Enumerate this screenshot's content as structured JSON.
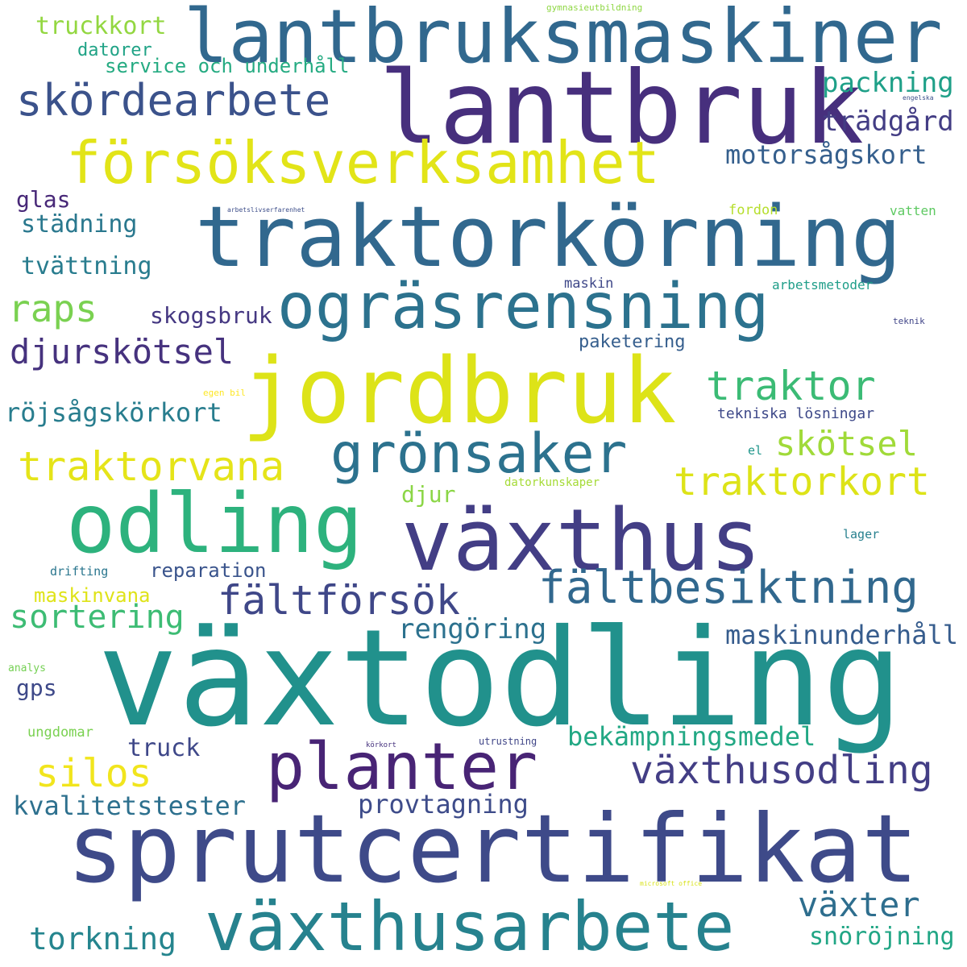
{
  "words": [
    {
      "text": "växtodling",
      "color": "#21918c"
    },
    {
      "text": "sprutcertifikat",
      "color": "#3e4a89"
    },
    {
      "text": "lantbruk",
      "color": "#472f7d"
    },
    {
      "text": "traktorkörning",
      "color": "#31688e"
    },
    {
      "text": "lantbruksmaskiner",
      "color": "#31688e"
    },
    {
      "text": "jordbruk",
      "color": "#dde318"
    },
    {
      "text": "växthus",
      "color": "#433e85"
    },
    {
      "text": "ogräsrensning",
      "color": "#2c728e"
    },
    {
      "text": "försöksverksamhet",
      "color": "#e2e418"
    },
    {
      "text": "odling",
      "color": "#2db27d"
    },
    {
      "text": "växthusarbete",
      "color": "#26828e"
    },
    {
      "text": "planter",
      "color": "#482475"
    },
    {
      "text": "grönsaker",
      "color": "#2c728e"
    },
    {
      "text": "fältbesiktning",
      "color": "#31688e"
    },
    {
      "text": "skördearbete",
      "color": "#3b528b"
    },
    {
      "text": "fältförsök",
      "color": "#3f4788"
    },
    {
      "text": "växthusodling",
      "color": "#433e85"
    },
    {
      "text": "traktorvana",
      "color": "#e5e419"
    },
    {
      "text": "traktorkort",
      "color": "#dde318"
    },
    {
      "text": "djurskötsel",
      "color": "#46327e"
    },
    {
      "text": "traktor",
      "color": "#3bbb75"
    },
    {
      "text": "raps",
      "color": "#7ad151"
    },
    {
      "text": "silos",
      "color": "#f1e51d"
    },
    {
      "text": "sortering",
      "color": "#3dbc74"
    },
    {
      "text": "skötsel",
      "color": "#a0da39"
    },
    {
      "text": "växter",
      "color": "#2e6e8e"
    },
    {
      "text": "röjsågskörkort",
      "color": "#287d8e"
    },
    {
      "text": "bekämpningsmedel",
      "color": "#22a884"
    },
    {
      "text": "kvalitetstester",
      "color": "#2d708e"
    },
    {
      "text": "provtagning",
      "color": "#3e4c8a"
    },
    {
      "text": "torkning",
      "color": "#25858e"
    },
    {
      "text": "snöröjning",
      "color": "#21a685"
    },
    {
      "text": "packning",
      "color": "#1fa088"
    },
    {
      "text": "trädgård",
      "color": "#433d84"
    },
    {
      "text": "motorsågskort",
      "color": "#355f8d"
    },
    {
      "text": "maskinunderhåll",
      "color": "#365c8d"
    },
    {
      "text": "rengöring",
      "color": "#2c718e"
    },
    {
      "text": "truckkort",
      "color": "#93d741"
    },
    {
      "text": "tvättning",
      "color": "#287c8e"
    },
    {
      "text": "städning",
      "color": "#2a788e"
    },
    {
      "text": "skogsbruk",
      "color": "#453882"
    },
    {
      "text": "reparation",
      "color": "#3a548c"
    },
    {
      "text": "maskinvana",
      "color": "#dfe318"
    },
    {
      "text": "service och underhåll",
      "color": "#25ab82"
    },
    {
      "text": "datorer",
      "color": "#20a386"
    },
    {
      "text": "glas",
      "color": "#482878"
    },
    {
      "text": "truck",
      "color": "#3f4889"
    },
    {
      "text": "djur",
      "color": "#8bd646"
    },
    {
      "text": "gps",
      "color": "#3e4989"
    },
    {
      "text": "paketering",
      "color": "#355e8d"
    },
    {
      "text": "tekniska lösningar",
      "color": "#3e4989"
    },
    {
      "text": "fordon",
      "color": "#b5de2b"
    },
    {
      "text": "vatten",
      "color": "#5ec962"
    },
    {
      "text": "maskin",
      "color": "#3f4889"
    },
    {
      "text": "arbetsmetoder",
      "color": "#1f9e89"
    },
    {
      "text": "datorkunskaper",
      "color": "#a5db36"
    },
    {
      "text": "lager",
      "color": "#27808e"
    },
    {
      "text": "drifting",
      "color": "#2a768e"
    },
    {
      "text": "ungdomar",
      "color": "#7ad151"
    },
    {
      "text": "analys",
      "color": "#75d054"
    },
    {
      "text": "el",
      "color": "#1f968b"
    },
    {
      "text": "teknik",
      "color": "#404588"
    },
    {
      "text": "utrustning",
      "color": "#404688"
    },
    {
      "text": "gymnasieutbildning",
      "color": "#8fd744"
    },
    {
      "text": "engelska",
      "color": "#3c4f8a"
    },
    {
      "text": "arbetslivserfarenhet",
      "color": "#3d4e8a"
    },
    {
      "text": "egen bil",
      "color": "#fde725"
    },
    {
      "text": "körkort",
      "color": "#46327e"
    },
    {
      "text": "microsoft office",
      "color": "#d8e219"
    }
  ]
}
